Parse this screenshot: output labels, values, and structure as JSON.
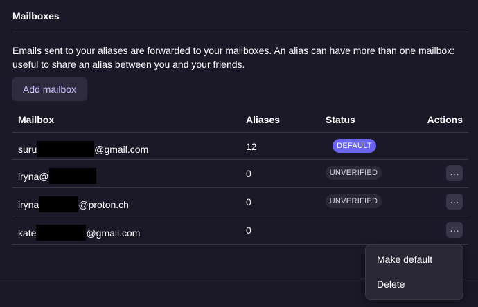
{
  "section": {
    "title": "Mailboxes",
    "description": "Emails sent to your aliases are forwarded to your mailboxes. An alias can have more than one mailbox: useful to share an alias between you and your friends.",
    "add_button": "Add mailbox"
  },
  "table": {
    "headers": {
      "mailbox": "Mailbox",
      "aliases": "Aliases",
      "status": "Status",
      "actions": "Actions"
    },
    "rows": [
      {
        "mailbox_prefix": "suru",
        "mailbox_suffix": "@gmail.com",
        "aliases": "12",
        "status": "DEFAULT"
      },
      {
        "mailbox_prefix": "iryna@",
        "mailbox_suffix": "",
        "aliases": "0",
        "status": "UNVERIFIED"
      },
      {
        "mailbox_prefix": "iryna",
        "mailbox_suffix": "@proton.ch",
        "aliases": "0",
        "status": "UNVERIFIED"
      },
      {
        "mailbox_prefix": "kate",
        "mailbox_suffix": "@gmail.com",
        "aliases": "0",
        "status": ""
      }
    ],
    "actions_icon": "···"
  },
  "menu": {
    "items": [
      "Make default",
      "Delete"
    ]
  },
  "colors": {
    "background": "#1b1928",
    "accent": "#6b63f2",
    "button_text": "#c9c4ff"
  },
  "icons": {
    "actions": "more-horizontal-icon"
  }
}
